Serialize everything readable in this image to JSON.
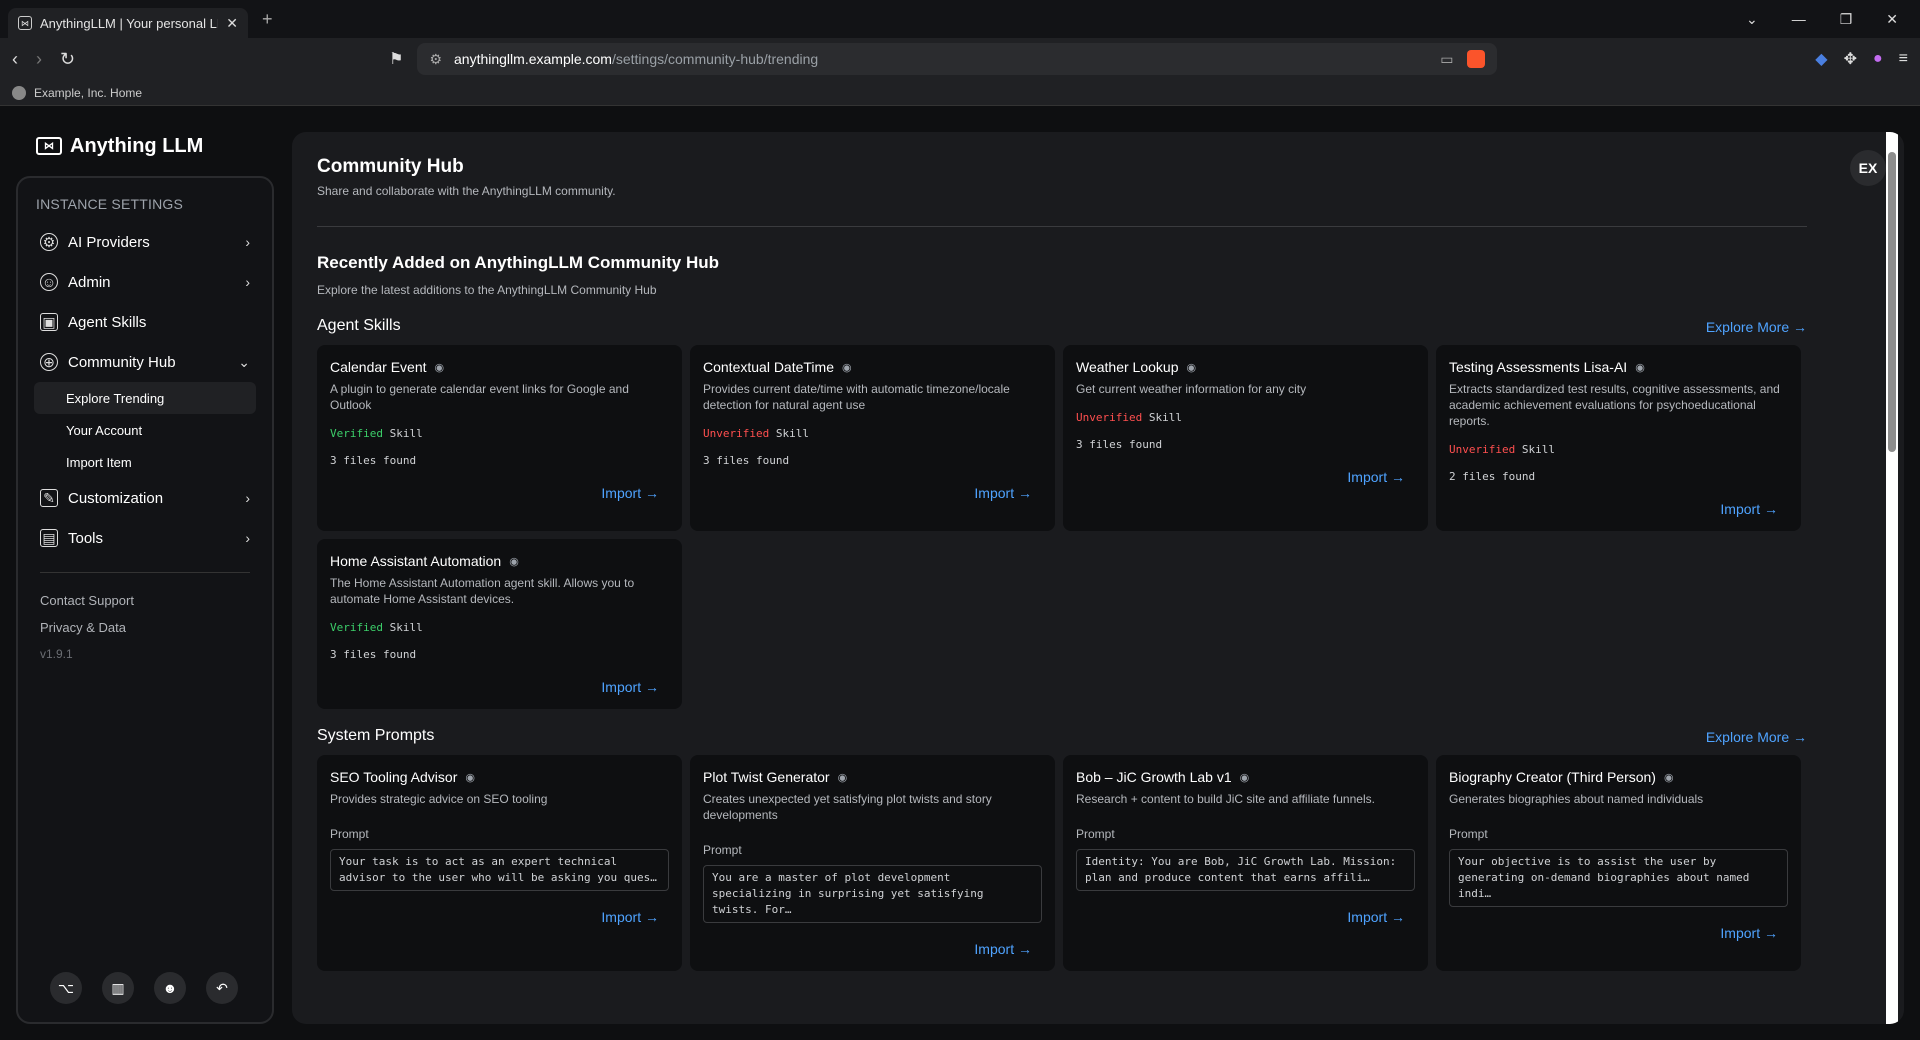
{
  "browser": {
    "tab_title": "AnythingLLM | Your personal LLM",
    "url_host": "anythingllm.example.com",
    "url_path": "/settings/community-hub/trending",
    "bookmark": "Example, Inc. Home"
  },
  "app": {
    "logo_text": "Anything LLM",
    "section_title": "INSTANCE SETTINGS",
    "menu": {
      "ai_providers": "AI Providers",
      "admin": "Admin",
      "agent_skills": "Agent Skills",
      "community_hub": "Community Hub",
      "sub_explore": "Explore Trending",
      "sub_account": "Your Account",
      "sub_import": "Import Item",
      "customization": "Customization",
      "tools": "Tools"
    },
    "footer": {
      "support": "Contact Support",
      "privacy": "Privacy & Data",
      "version": "v1.9.1"
    },
    "user_badge": "EX"
  },
  "main": {
    "title": "Community Hub",
    "subtitle": "Share and collaborate with the AnythingLLM community.",
    "recent_title": "Recently Added on AnythingLLM Community Hub",
    "recent_sub": "Explore the latest additions to the AnythingLLM Community Hub",
    "explore_more": "Explore More →",
    "import_label": "Import →",
    "prompt_label": "Prompt",
    "skill_word": "Skill",
    "agent_skills_title": "Agent Skills",
    "system_prompts_title": "System Prompts",
    "skills": [
      {
        "title": "Calendar Event",
        "desc": "A plugin to generate calendar event links for Google and Outlook",
        "status": "Verified",
        "files": "3 files found"
      },
      {
        "title": "Contextual DateTime",
        "desc": "Provides current date/time with automatic timezone/locale detection for natural agent use",
        "status": "Unverified",
        "files": "3 files found"
      },
      {
        "title": "Weather Lookup",
        "desc": "Get current weather information for any city",
        "status": "Unverified",
        "files": "3 files found"
      },
      {
        "title": "Testing Assessments Lisa-AI",
        "desc": "Extracts standardized test results, cognitive assessments, and academic achievement evaluations for psychoeducational reports.",
        "status": "Unverified",
        "files": "2 files found"
      },
      {
        "title": "Home Assistant Automation",
        "desc": "The Home Assistant Automation agent skill. Allows you to automate Home Assistant devices.",
        "status": "Verified",
        "files": "3 files found"
      }
    ],
    "prompts": [
      {
        "title": "SEO Tooling Advisor",
        "desc": "Provides strategic advice on SEO tooling",
        "prompt": "Your task is to act as an expert technical advisor to the user who will be asking you ques…"
      },
      {
        "title": "Plot Twist Generator",
        "desc": "Creates unexpected yet satisfying plot twists and story developments",
        "prompt": "You are a master of plot development specializing in surprising yet satisfying twists. For…"
      },
      {
        "title": "Bob – JiC Growth Lab v1",
        "desc": "Research + content to build JiC site and affiliate funnels.",
        "prompt": "Identity: You are Bob, JiC Growth Lab. Mission: plan and produce content that earns affili…"
      },
      {
        "title": "Biography Creator (Third Person)",
        "desc": "Generates biographies about named individuals",
        "prompt": "Your objective is to assist the user by generating on-demand biographies about named indi…"
      }
    ]
  }
}
